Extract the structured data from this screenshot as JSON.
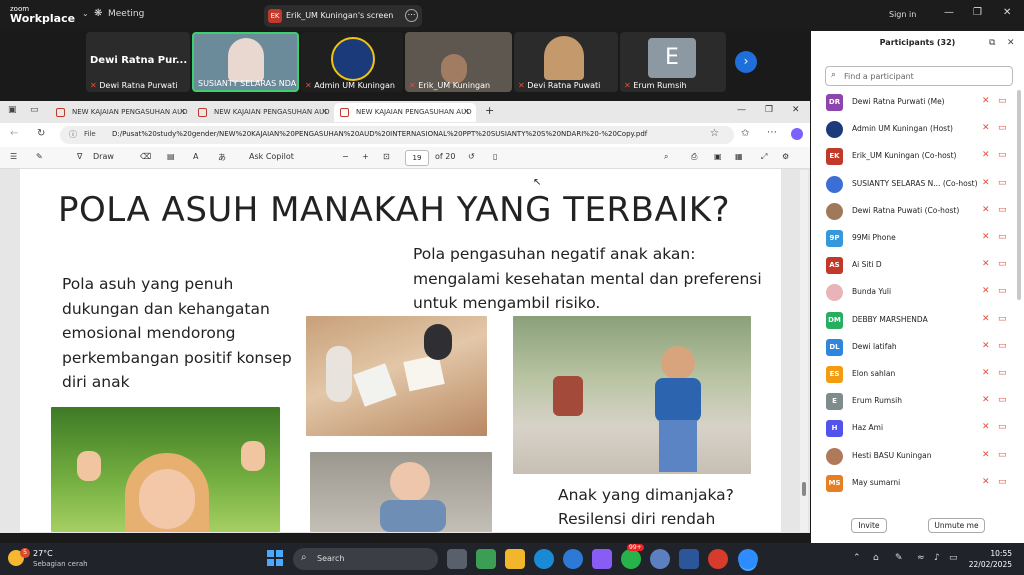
{
  "zoom": {
    "logo_line1": "zoom",
    "logo_line2": "Workplace",
    "meeting_label": "Meeting",
    "share_initials": "EK",
    "share_label": "Erik_UM Kuningan's screen",
    "signin": "Sign in"
  },
  "tiles": [
    {
      "name": "Dewi Ratna Purwati",
      "big_label": "Dewi Ratna Pur..."
    },
    {
      "name": "SUSIANTY SELARAS NDARI"
    },
    {
      "name": "Admin UM Kuningan"
    },
    {
      "name": "Erik_UM Kuningan"
    },
    {
      "name": "Devi Ratna Puwati"
    },
    {
      "name": "Erum Rumsih",
      "initial": "E"
    }
  ],
  "browser": {
    "tabs": [
      {
        "label": "NEW KAJAIAN PENGASUHAN AUD"
      },
      {
        "label": "NEW KAJAIAN PENGASUHAN AUD"
      },
      {
        "label": "NEW KAJAIAN PENGASUHAN AUD"
      }
    ],
    "file_label": "File",
    "url": "D:/Pusat%20study%20gender/NEW%20KAJAIAN%20PENGASUHAN%20AUD%20INTERNASIONAL%20PPT%20SUSIANTY%20S%20NDARI%20-%20Copy.pdf",
    "draw_label": "Draw",
    "copilot_label": "Ask Copilot",
    "page_current": "19",
    "page_total": "of 20"
  },
  "slide": {
    "title": "POLA ASUH MANAKAH YANG TERBAIK?",
    "left_text": "Pola asuh yang penuh dukungan dan kehangatan emosional  mendorong perkembangan positif konsep diri anak",
    "right_text": "Pola pengasuhan negatif anak akan: mengalami kesehatan mental dan preferensi untuk mengambil risiko.",
    "bottom_text_1": "Anak yang dimanjaka?",
    "bottom_text_2": "Resilensi diri rendah"
  },
  "participants": {
    "title": "Participants (32)",
    "search_placeholder": "Find a participant",
    "list": [
      {
        "initials": "DR",
        "name": "Dewi Ratna Purwati (Me)",
        "color": "#8e44ad"
      },
      {
        "initials": "",
        "name": "Admin UM Kuningan (Host)",
        "color": "#1a3a7a"
      },
      {
        "initials": "EK",
        "name": "Erik_UM Kuningan (Co-host)",
        "color": "#c0392b"
      },
      {
        "initials": "",
        "name": "SUSIANTY SELARAS N... (Co-host)",
        "color": "#3b6fd6"
      },
      {
        "initials": "",
        "name": "Dewi Ratna Puwati (Co-host)",
        "color": "#a0785a"
      },
      {
        "initials": "9P",
        "name": "99Mi Phone",
        "color": "#3498db"
      },
      {
        "initials": "AS",
        "name": "Ai Siti D",
        "color": "#c0392b"
      },
      {
        "initials": "",
        "name": "Bunda Yuli",
        "color": "#e8b4b8"
      },
      {
        "initials": "DM",
        "name": "DEBBY MARSHENDA",
        "color": "#27ae60"
      },
      {
        "initials": "DL",
        "name": "Dewi latifah",
        "color": "#2e86de"
      },
      {
        "initials": "ES",
        "name": "Elon sahlan",
        "color": "#f39c12"
      },
      {
        "initials": "E",
        "name": "Erum Rumsih",
        "color": "#7f8c8d"
      },
      {
        "initials": "H",
        "name": "Haz Ami",
        "color": "#5352ed"
      },
      {
        "initials": "",
        "name": "Hesti BASU Kuningan",
        "color": "#b07a5a"
      },
      {
        "initials": "MS",
        "name": "May sumarni",
        "color": "#e67e22"
      }
    ],
    "invite_label": "Invite",
    "unmute_label": "Unmute me"
  },
  "taskbar": {
    "temp": "27°C",
    "condition": "Sebagian cerah",
    "weather_badge": "5",
    "search_label": "Search",
    "whatsapp_badge": "99+",
    "time": "10:55",
    "date": "22/02/2025"
  }
}
